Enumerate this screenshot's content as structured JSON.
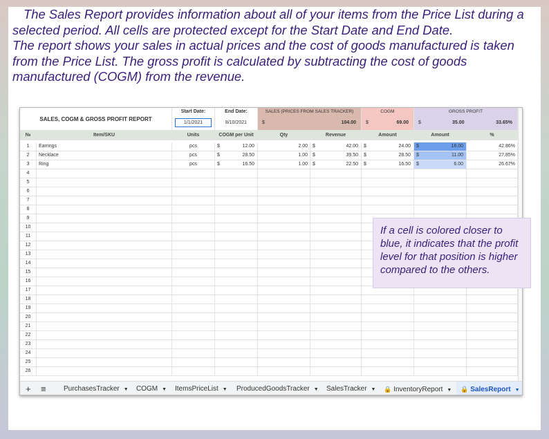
{
  "intro": {
    "line1": "The Sales Report provides information about all of your items from the Price List during a selected period. All cells are protected except for the Start Date and End Date.",
    "line2": "The report shows your sales in actual prices and the cost of goods manufactured is taken from the Price List. The gross profit is calculated by subtracting the cost of goods manufactured (COGM) from the revenue."
  },
  "callout": "If a cell is colored closer to blue, it indicates that the profit level for that position is higher compared to the others.",
  "report": {
    "title": "SALES, COGM & GROSS PROFIT REPORT",
    "start_label": "Start Date:",
    "start_value": "1/1/2021",
    "end_label": "End Date:",
    "end_value": "8/10/2021",
    "sales_label": "SALES (PRICES FROM SALES TRACKER)",
    "sales_currency": "$",
    "sales_total": "104.00",
    "cogm_label": "COGM",
    "cogm_currency": "$",
    "cogm_total": "69.00",
    "gp_label": "GROSS PROFIT",
    "gp_currency": "$",
    "gp_total": "35.00",
    "gp_pct": "33.65%"
  },
  "columns": [
    "№",
    "Item/SKU",
    "Units",
    "COGM per Unit",
    "Qty",
    "Revenue",
    "Amount",
    "Amount",
    "%"
  ],
  "rows": [
    {
      "n": "1",
      "item": "Earrings",
      "units": "pcs",
      "cogm_cur": "$",
      "cogm": "12.00",
      "qty": "2.00",
      "rev_cur": "$",
      "rev": "42.00",
      "amt_cur": "$",
      "amt": "24.00",
      "gp_cur": "$",
      "gp": "18.00",
      "pct": "42.86%",
      "gp_color": "#6d9eeb"
    },
    {
      "n": "2",
      "item": "Necklace",
      "units": "pcs",
      "cogm_cur": "$",
      "cogm": "28.50",
      "qty": "1.00",
      "rev_cur": "$",
      "rev": "39.50",
      "amt_cur": "$",
      "amt": "28.50",
      "gp_cur": "$",
      "gp": "11.00",
      "pct": "27.85%",
      "gp_color": "#a4c2f4"
    },
    {
      "n": "3",
      "item": "Ring",
      "units": "pcs",
      "cogm_cur": "$",
      "cogm": "16.50",
      "qty": "1.00",
      "rev_cur": "$",
      "rev": "22.50",
      "amt_cur": "$",
      "amt": "16.50",
      "gp_cur": "$",
      "gp": "6.00",
      "pct": "26.67%",
      "gp_color": "#c9daf8"
    }
  ],
  "empty_rows": [
    "4",
    "5",
    "6",
    "7",
    "8",
    "9",
    "10",
    "11",
    "12",
    "13",
    "14",
    "15",
    "16",
    "17",
    "18",
    "19",
    "20",
    "21",
    "22",
    "23",
    "24",
    "25",
    "26"
  ],
  "tabs": {
    "add": "+",
    "menu": "≡",
    "items": [
      "PurchasesTracker",
      "COGM",
      "ItemsPriceList",
      "ProducedGoodsTracker",
      "SalesTracker",
      "InventoryReport",
      "SalesReport"
    ],
    "active": "SalesReport"
  },
  "colors": {
    "sales_header": "#d9b8ad",
    "cogm_header": "#f4c7c3",
    "gp_header": "#d9d2e9",
    "text_purple": "#3a1f7a",
    "active_tab": "#1a55c4"
  }
}
